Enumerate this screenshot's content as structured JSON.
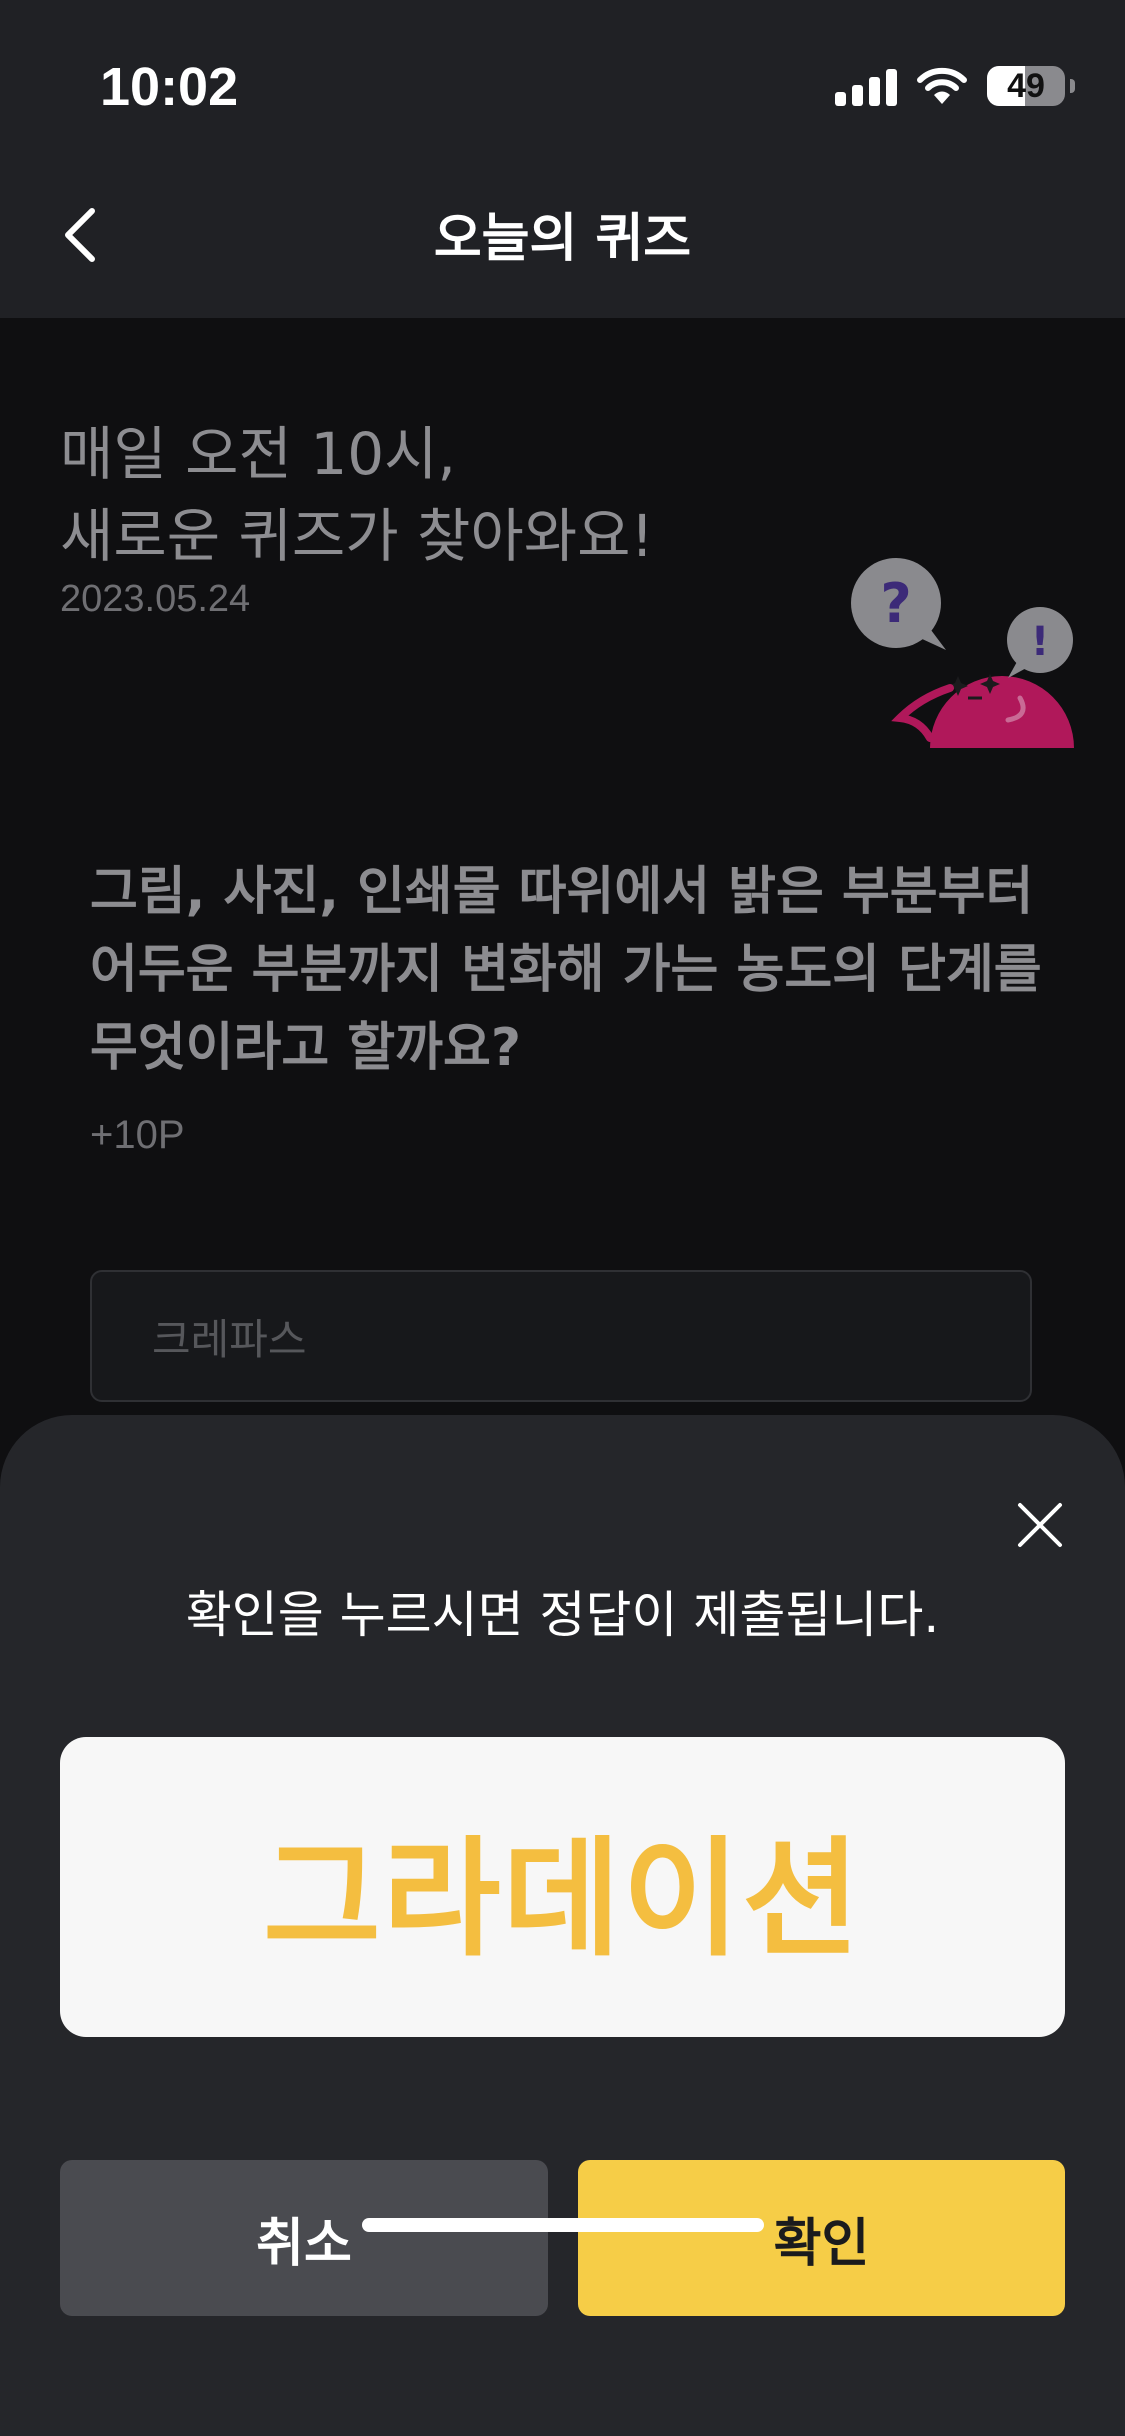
{
  "status_bar": {
    "time": "10:02",
    "battery": "49",
    "battery_level": 0.49,
    "icons": [
      "cellular-signal-icon",
      "wifi-icon",
      "battery-icon"
    ]
  },
  "header": {
    "title": "오늘의 퀴즈",
    "back_icon": "chevron-left-icon"
  },
  "quiz": {
    "intro_line1": "매일 오전 10시,",
    "intro_line2": "새로운 퀴즈가 찾아와요!",
    "date": "2023.05.24",
    "question": "그림, 사진, 인쇄물 따위에서 밝은 부분부터 어두운 부분까지 변화해 가는 농도의 단계를 무엇이라고 할까요?",
    "points": "+10P",
    "input_placeholder": "크레파스",
    "mascot_icon": "quiz-mascot-illustration",
    "mascot_bubbles": [
      "?",
      "!"
    ]
  },
  "sheet": {
    "message": "확인을 누르시면 정답이 제출됩니다.",
    "answer": "그라데이션",
    "cancel_label": "취소",
    "confirm_label": "확인",
    "close_icon": "close-icon"
  },
  "colors": {
    "accent": "#f6cd47",
    "answer_text": "#f4be40",
    "sheet_bg": "#25262a",
    "cancel_bg": "#4a4b50",
    "mascot": "#b0185a"
  }
}
